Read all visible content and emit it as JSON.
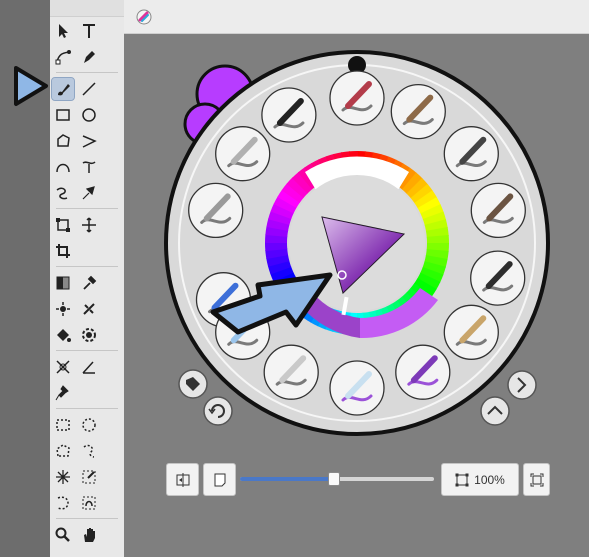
{
  "app": {
    "logo_icon": "app-logo-icon"
  },
  "toolbox": {
    "selected_tool": "brush",
    "tools": [
      [
        "selection-arrow",
        "text"
      ],
      [
        "path-edit",
        "pen"
      ],
      [
        "brush",
        "line"
      ],
      [
        "rectangle",
        "ellipse"
      ],
      [
        "polygon",
        "polyline"
      ],
      [
        "bezier",
        "freehand-bezier"
      ],
      [
        "freehand",
        "dynamic-brush"
      ],
      [
        "transform",
        "move"
      ],
      [
        "crop",
        ""
      ],
      [
        "gradient",
        "colour-picker"
      ],
      [
        "smart-patch",
        "assistant"
      ],
      [
        "fill",
        "enclose-fill"
      ],
      [
        "measure",
        "measure-angle"
      ],
      [
        "reference-pin",
        ""
      ],
      [
        "rect-select",
        "ellipse-select"
      ],
      [
        "polygon-select",
        "freehand-select"
      ],
      [
        "contiguous-select",
        "similar-select"
      ],
      [
        "outline-select",
        "bezier-select"
      ],
      [
        "zoom",
        "pan"
      ]
    ]
  },
  "colors": {
    "accent_purple": "#b73cff",
    "wheel_bg": "#d9d9d9",
    "selection_blue": "#4a78c8",
    "slot_purple": "#c45cf4"
  },
  "brush_wheel": {
    "brushes": [
      "eraser-brush",
      "smudge-brush",
      "airbrush",
      "pencil",
      "marker-pen",
      "round-brush",
      "flat-brush",
      "fan-brush",
      "stroke-brush",
      "detail-brush",
      "watercolour-brush",
      "liquid-brush",
      "blender-brush",
      "symmetry-brush"
    ],
    "buttons": [
      "brush-tag-button",
      "refresh-button",
      "next-button",
      "collapse-button"
    ]
  },
  "bottom_toolbar": {
    "zoom_label": "100%",
    "slider_value_fraction": 0.48
  }
}
